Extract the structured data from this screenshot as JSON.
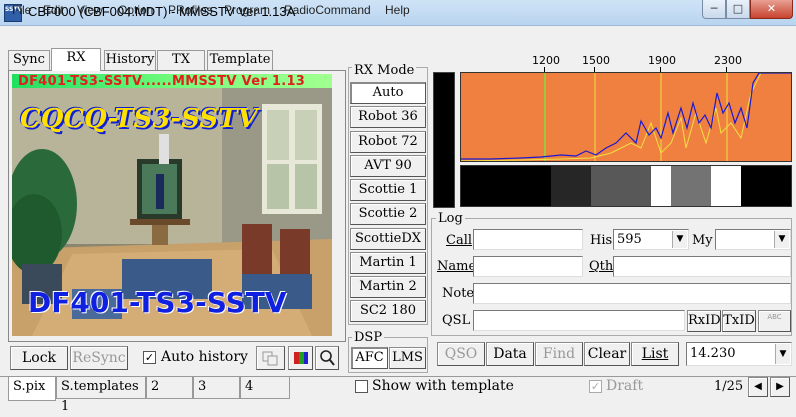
{
  "window": {
    "title": "CBF000 (CBF004.MDT) - MMSSTV Ver 1.13A",
    "icon_text": "SSTV"
  },
  "controls": {
    "minimize": "─",
    "maximize": "□",
    "close": "✕"
  },
  "menu": [
    "File",
    "Edit",
    "View",
    "Option",
    "PRofiles",
    "Program",
    "RadioCommand",
    "Help"
  ],
  "tabs": [
    "Sync",
    "RX",
    "History",
    "TX",
    "Template"
  ],
  "active_tab": "RX",
  "picture": {
    "status_bar": "DF401-TS3-SSTV......MMSSTV Ver 1.13",
    "cq_text": "CQCQ-TS3-SSTV",
    "call_text": "DF401-TS3-SSTV"
  },
  "picture_controls": {
    "lock": "Lock",
    "resync": "ReSync",
    "auto_history": "Auto history",
    "auto_history_checked": true
  },
  "rx_mode": {
    "title": "RX Mode",
    "modes": [
      "Auto",
      "Robot 36",
      "Robot 72",
      "AVT 90",
      "Scottie 1",
      "Scottie 2",
      "ScottieDX",
      "Martin 1",
      "Martin 2",
      "SC2 180"
    ],
    "selected": "Auto"
  },
  "dsp": {
    "title": "DSP",
    "afc": "AFC",
    "lms": "LMS"
  },
  "spectrum": {
    "ticks": [
      "1200",
      "1500",
      "1900",
      "2300"
    ],
    "colors": {
      "bg": "#f08040",
      "trace": "#1a1ad0",
      "marker": "#c0e040"
    }
  },
  "log": {
    "title": "Log",
    "labels": {
      "call": "Call",
      "his": "His",
      "my": "My",
      "name": "Name",
      "qth": "Qth",
      "note": "Note",
      "qsl": "QSL"
    },
    "values": {
      "call": "",
      "his": "595",
      "my": "",
      "name": "",
      "qth": "",
      "note": "",
      "qsl": ""
    },
    "rxid": "RxID",
    "txid": "TxID",
    "abc": "ABC",
    "buttons": {
      "qso": "QSO",
      "data": "Data",
      "find": "Find",
      "clear": "Clear",
      "list": "List"
    },
    "frequency": "14.230"
  },
  "bottom_tabs": [
    "S.pix",
    "S.templates 1",
    "2",
    "3",
    "4"
  ],
  "bottom": {
    "show_template": "Show with template",
    "draft": "Draft",
    "page": "1/25"
  }
}
